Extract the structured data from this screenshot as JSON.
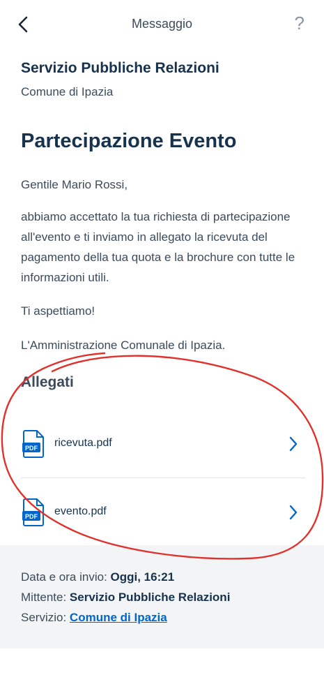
{
  "header": {
    "title": "Messaggio",
    "help_label": "?"
  },
  "message": {
    "sender_name": "Servizio Pubbliche Relazioni",
    "sender_org": "Comune di Ipazia",
    "subject": "Partecipazione Evento",
    "greeting": "Gentile Mario Rossi,",
    "paragraph": "abbiamo accettato la tua richiesta di partecipazione all'evento e ti inviamo in allegato la ricevuta del pagamento della tua quota e la brochure con tutte le informazioni utili.",
    "closing": "Ti aspettiamo!",
    "signature": "L'Amministrazione Comunale di Ipazia."
  },
  "attachments": {
    "title": "Allegati",
    "items": [
      {
        "name": "ricevuta.pdf",
        "icon": "pdf-icon",
        "badge": "PDF"
      },
      {
        "name": "evento.pdf",
        "icon": "pdf-icon",
        "badge": "PDF"
      }
    ]
  },
  "footer": {
    "date_label": "Data e ora invio: ",
    "date_value": "Oggi, 16:21",
    "sender_label": "Mittente: ",
    "sender_value": "Servizio Pubbliche Relazioni",
    "service_label": "Servizio: ",
    "service_value": "Comune di Ipazia"
  },
  "colors": {
    "accent": "#0066cc",
    "title": "#17324d",
    "annotation": "#e0312b",
    "footer_bg": "#f2f4f5"
  }
}
